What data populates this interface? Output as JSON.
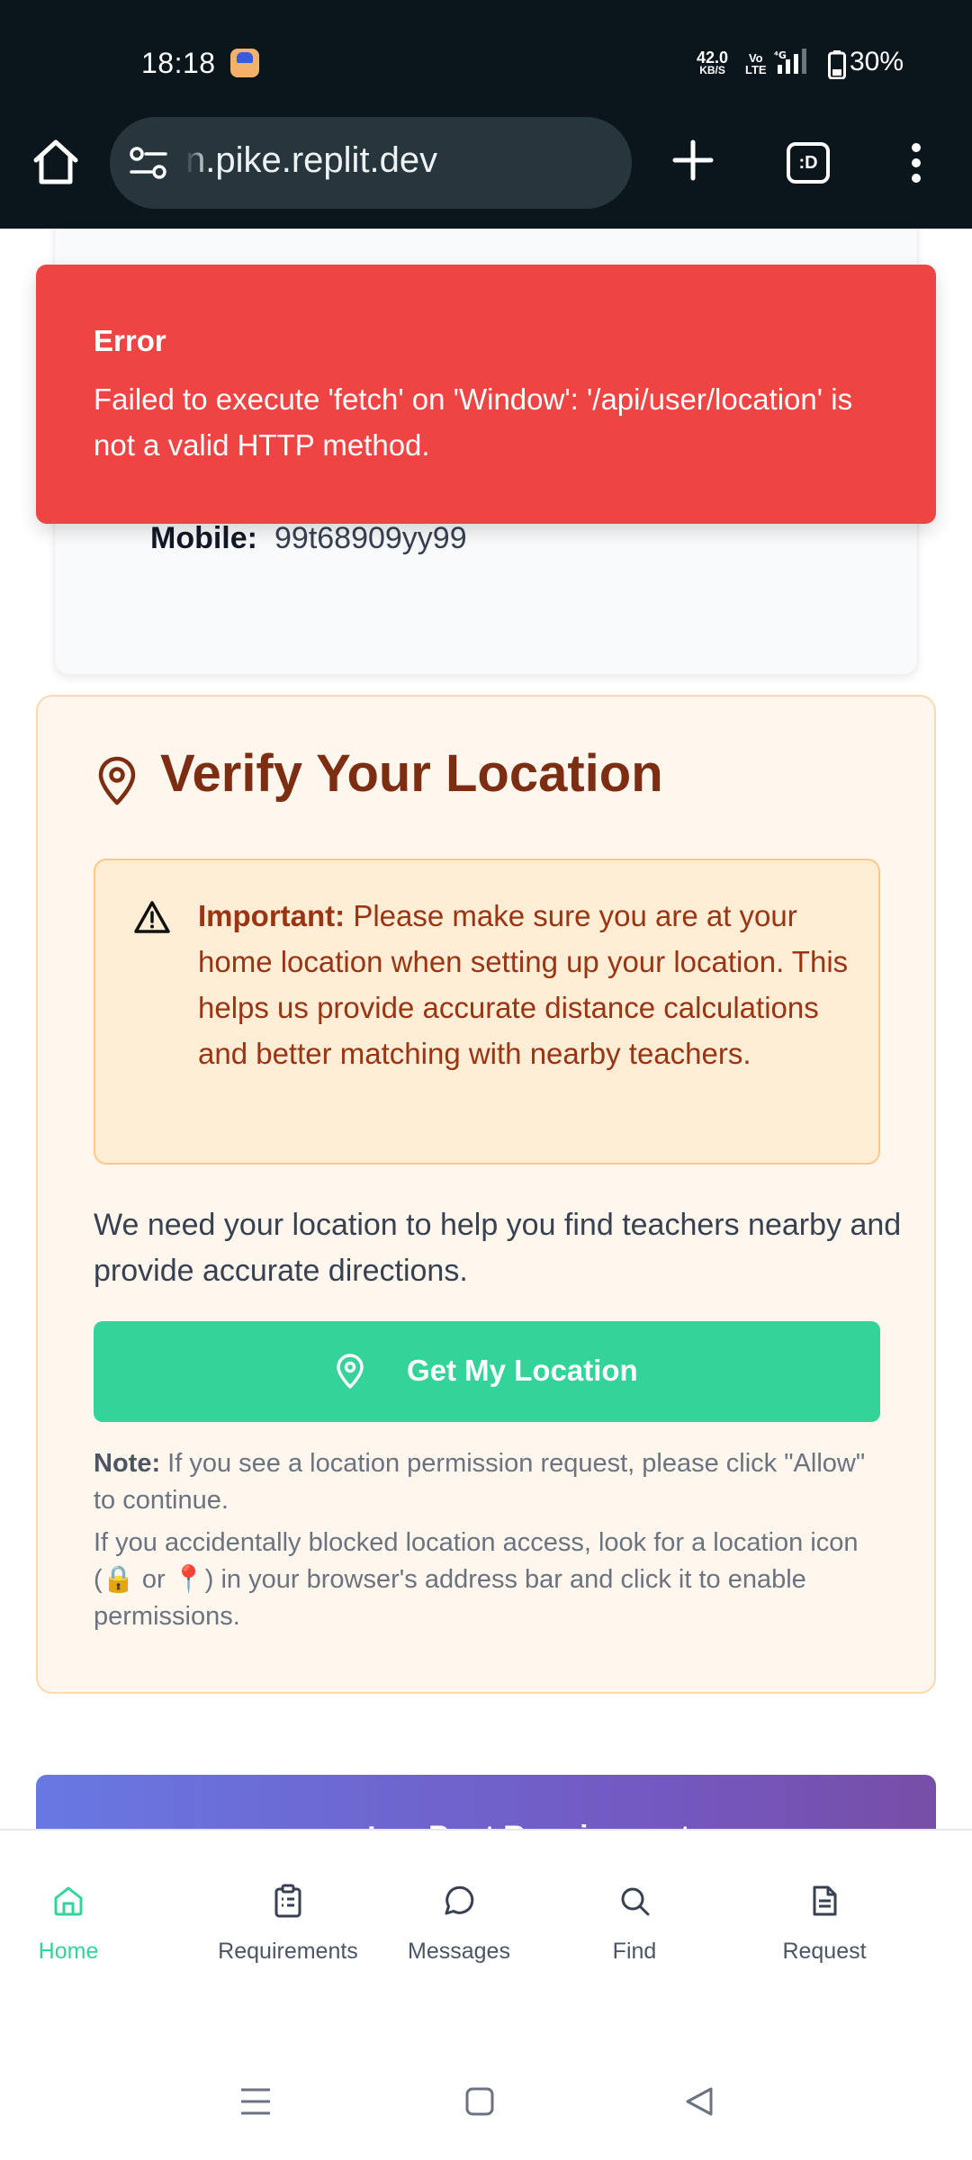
{
  "status_bar": {
    "time": "18:18",
    "net_speed_value": "42.0",
    "net_speed_unit": "KB/S",
    "volte_line1": "Vo",
    "volte_line2": "LTE",
    "battery": "30%"
  },
  "browser": {
    "url": "n.pike.replit.dev",
    "tabs_label": ":D"
  },
  "profile": {
    "mobile_label": "Mobile:",
    "mobile_value": "99t68909yy99"
  },
  "toast": {
    "title": "Error",
    "message": "Failed to execute 'fetch' on 'Window': '/api/user/location' is not a valid HTTP method."
  },
  "location": {
    "title": "Verify Your Location",
    "alert_strong": "Important:",
    "alert_text": "Please make sure you are at your home location when setting up your location. This helps us provide accurate distance calculations and better matching with nearby teachers.",
    "description": "We need your location to help you find teachers nearby and provide accurate directions.",
    "button_label": "Get My Location",
    "note_strong": "Note:",
    "note_text": "If you see a location permission request, please click \"Allow\" to continue.",
    "note_text2": "If you accidentally blocked location access, look for a location icon (🔒 or 📍) in your browser's address bar and click it to enable permissions."
  },
  "post_button": {
    "plus": "+",
    "label": "Post Requirement"
  },
  "bottom_nav": {
    "items": [
      {
        "label": "Home",
        "icon": "home-icon",
        "active": true
      },
      {
        "label": "Requirements",
        "icon": "clipboard-icon",
        "active": false
      },
      {
        "label": "Messages",
        "icon": "chat-bubble-icon",
        "active": false
      },
      {
        "label": "Find",
        "icon": "search-icon",
        "active": false
      },
      {
        "label": "Request",
        "icon": "document-icon",
        "active": false
      }
    ]
  },
  "colors": {
    "accent_green": "#34d399",
    "error_red": "#ef4444",
    "title_brown": "#7c2d12",
    "alert_text": "#9a3412"
  }
}
